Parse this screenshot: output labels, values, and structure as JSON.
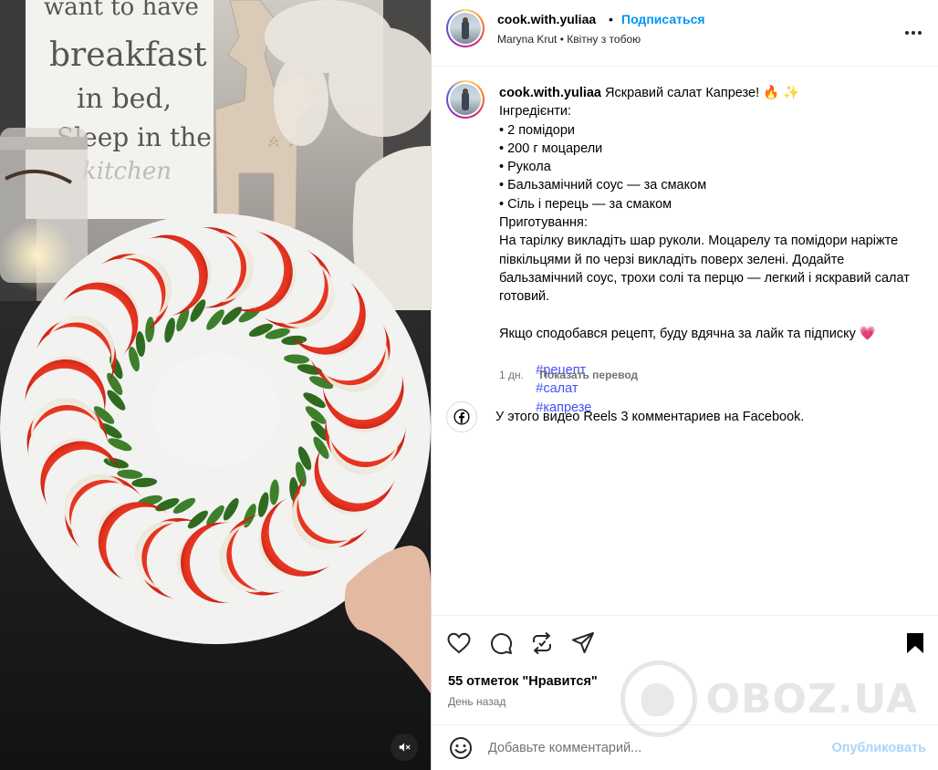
{
  "media": {
    "sign_lines": [
      "want to have",
      "breakfast",
      "in bed,",
      "Sleep in the",
      "kitchen"
    ],
    "mute_icon": "speaker-muted-icon"
  },
  "header": {
    "username": "cook.with.yuliaa",
    "bullet": "•",
    "follow_label": "Подписаться",
    "subline": "Maryna Krut • Квітну з тобою",
    "more_icon": "more-options-icon"
  },
  "caption": {
    "username": "cook.with.yuliaa",
    "first_line": "Яскравий салат Капрезе! 🔥 ✨",
    "lines": [
      "Інгредієнти:",
      "• 2 помідори",
      "• 200 г моцарели",
      "• Рукола",
      "• Бальзамічний соус — за смаком",
      "• Сіль і перець — за смаком",
      "Приготування:",
      "На тарілку викладіть шар руколи. Моцарелу та помідори наріжте півкільцями й по черзі викладіть поверх зелені. Додайте бальзамічний соус, трохи солі та перцю — легкий і яскравий салат готовий."
    ],
    "closing_line": "Якщо сподобався рецепт, буду вдячна за лайк та підписку",
    "closing_emoji": "💗",
    "hashtags": [
      "#рецепт",
      "#салат",
      "#капрезе"
    ],
    "time": "1 дн.",
    "translate_label": "Показать перевод"
  },
  "facebook_note": {
    "text": "У этого видео Reels 3 комментариев на Facebook.",
    "icon": "facebook-icon"
  },
  "actions": {
    "icons": [
      "heart-icon",
      "comment-icon",
      "repost-icon",
      "share-icon",
      "save-icon"
    ],
    "likes_text": "55 отметок \"Нравится\"",
    "posted_text": "День назад"
  },
  "comment": {
    "placeholder": "Добавьте комментарий...",
    "publish_label": "Опубликовать",
    "emoji_icon": "emoji-icon"
  },
  "watermark": {
    "text": "OBOZ.UA"
  },
  "colors": {
    "accent": "#0095f6",
    "hashtag": "#4150f7",
    "muted": "#737373",
    "publish_disabled": "#a8d4fc",
    "tomato": "#e0301e",
    "mozzarella": "#f3efe6",
    "arugula": "#2f6b1f"
  }
}
